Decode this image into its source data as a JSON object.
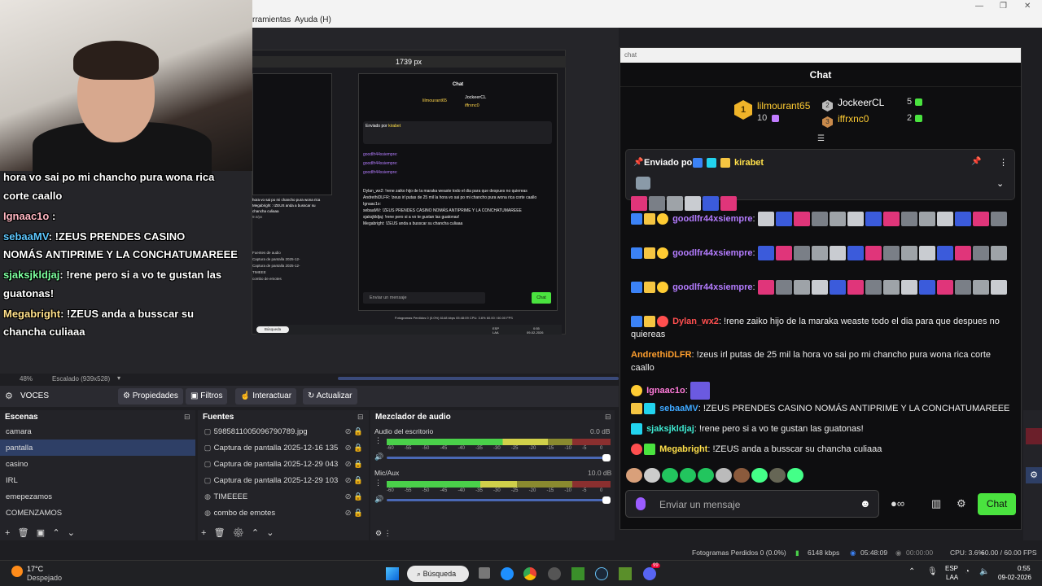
{
  "menu": {
    "items": [
      "rramientas",
      "Ayuda (H)"
    ]
  },
  "preview": {
    "px_label": "1739 px",
    "overlay": [
      {
        "user": "",
        "text": "hora vo sai po mi chancho pura wona rica"
      },
      {
        "user": "",
        "text": "corte caallo"
      },
      {
        "user": "Ignaac1o",
        "text": ":"
      },
      {
        "user": "sebaaMV",
        "text": ": !ZEUS PRENDES CASINO"
      },
      {
        "user": "",
        "text": "NOMÁS ANTIPRIME Y LA CONCHATUMAREEE"
      },
      {
        "user": "sjaksjkldjaj",
        "text": ": !rene pero si a vo te gustan las"
      },
      {
        "user": "",
        "text": "guatonas!"
      },
      {
        "user": "Megabright",
        "text": ": !ZEUS anda a busscar su"
      },
      {
        "user": "",
        "text": "chancha culiaaa"
      }
    ],
    "mini_chat": {
      "title": "Chat",
      "top1": "lilmourant65",
      "top2": "JockeerCL",
      "top3": "iffrxnc0",
      "pinned_label": "Enviado por",
      "pinned_user": "kirabet",
      "lines": [
        "goodlfr44xsiempre:",
        "goodlfr44xsiempre:",
        "goodlfr44xsiempre:",
        "Dylan_wx2: !rene zaiko hijo de la maraka weaste todo el dia para que despues no quiereas",
        "AndrethiDLFR: !zeus irl putas de 25 mil la hora vo sai po mi chancho pura wona rica corte caallo",
        "Ignaac1o:",
        "sebaaMV: !ZEUS PRENDES CASINO NOMÁS ANTIPRIME Y LA CONCHATUMAREEE",
        "sjaksjkldjaj: !rene pero si a vo te gustan las guatonas!",
        "Megabright: !ZEUS anda a busscar su chancha culiaaa"
      ],
      "input_placeholder": "Enviar un mensaje",
      "chat_btn": "Chat"
    },
    "mini_obs_overlay": [
      "hora vo sai po mi chancho pura wona rica",
      "Megabright : !ZEUS anda a busscar su",
      "chancha culiaaa"
    ],
    "mini_scale_label": "9:4/px",
    "mini_sources": [
      "Fuentes de audio",
      "Captura de pantalla 2025-12-",
      "Captura de pantalla 2025-12-",
      "TIMEEE",
      "combo de emotes"
    ],
    "mini_status": "Fotogramas Perdidos 0 (0.0%)   6148 kbps   05:48:09   CPU: 3.6%   60.00 / 60.00 FPS",
    "mini_search": "Búsqueda",
    "mini_tray": [
      "ESP",
      "LAA",
      "0:55",
      "09-02-2026"
    ]
  },
  "zoom": {
    "percent": "48%",
    "scale": "Escalado (939x528)"
  },
  "toolbar": {
    "source_name": "VOCES",
    "props": "Propiedades",
    "filters": "Filtros",
    "interact": "Interactuar",
    "refresh": "Actualizar"
  },
  "scenes": {
    "title": "Escenas",
    "items": [
      "camara",
      "pantalla",
      "casino",
      "IRL",
      "emepezamos",
      "COMENZAMOS"
    ],
    "selected": "pantalla"
  },
  "sources": {
    "title": "Fuentes",
    "items": [
      "5985811005096790789.jpg",
      "Captura de pantalla 2025-12-16 135",
      "Captura de pantalla 2025-12-29 043",
      "Captura de pantalla 2025-12-29 103",
      "TIMEEEE",
      "combo de emotes"
    ]
  },
  "mixer": {
    "title": "Mezclador de audio",
    "channels": [
      {
        "name": "Audio del escritorio",
        "db": "0.0 dB",
        "level": 0.72
      },
      {
        "name": "Mic/Aux",
        "db": "10.0 dB",
        "level": 0.58
      }
    ],
    "ticks": [
      "-60",
      "-55",
      "-50",
      "-45",
      "-40",
      "-35",
      "-30",
      "-25",
      "-20",
      "-15",
      "-10",
      "-5",
      "0"
    ]
  },
  "chat": {
    "window_title": "chat",
    "header": "Chat",
    "leaderboard": [
      {
        "rank": "1",
        "name": "lilmourant65",
        "points": "10"
      },
      {
        "rank": "2",
        "name": "JockeerCL",
        "points": "5"
      },
      {
        "rank": "3",
        "name": "iffrxnc0",
        "points": "2"
      }
    ],
    "pinned": {
      "label": "Enviado por",
      "user": "kirabet"
    },
    "messages": [
      {
        "user": "goodlfr44xsiempre",
        "text": ":",
        "color": "#b47cff"
      },
      {
        "user": "goodlfr44xsiempre",
        "text": ":",
        "color": "#b47cff"
      },
      {
        "user": "goodlfr44xsiempre",
        "text": ":",
        "color": "#b47cff"
      },
      {
        "user": "Dylan_wx2",
        "text": ": !rene zaiko hijo de la maraka weaste todo el dia para que despues no quiereas",
        "color": "#ff4f4f"
      },
      {
        "user": "AndrethiDLFR",
        "text": ": !zeus irl putas de 25 mil la hora vo sai po mi chancho pura wona rica corte caallo",
        "color": "#ff9f2e"
      },
      {
        "user": "Ignaac1o",
        "text": ":",
        "color": "#ff7ad9"
      },
      {
        "user": "sebaaMV",
        "text": ": !ZEUS PRENDES CASINO NOMÁS ANTIPRIME Y LA CONCHATUMAREEE",
        "color": "#3ea8ff"
      },
      {
        "user": "sjaksjkldjaj",
        "text": ": !rene pero si a vo te gustan las guatonas!",
        "color": "#3ee8d0"
      },
      {
        "user": "Megabright",
        "text": ": !ZEUS anda a busscar su chancha culiaaa",
        "color": "#ffe04a"
      }
    ],
    "input_placeholder": "Enviar un mensaje",
    "send_label": "Chat"
  },
  "obs_status": {
    "dropped": "Fotogramas Perdidos 0 (0.0%)",
    "kbps": "6148 kbps",
    "stream_time": "05:48:09",
    "rec_time": "00:00:00",
    "cpu": "CPU: 3.6%",
    "fps": "60.00 / 60.00 FPS"
  },
  "taskbar": {
    "weather_temp": "17°C",
    "weather_desc": "Despejado",
    "search": "Búsqueda",
    "lang1": "ESP",
    "lang2": "LAA",
    "time": "0:55",
    "date": "09-02-2026",
    "badge": "99"
  }
}
